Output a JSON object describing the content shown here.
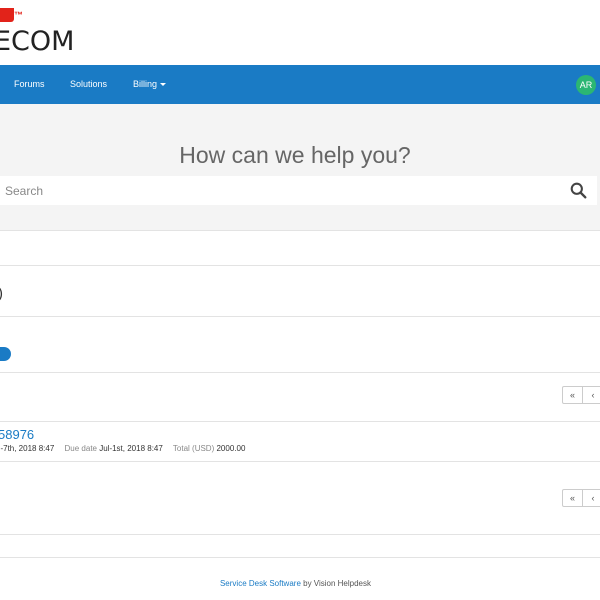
{
  "brand": {
    "logo_tm": "™",
    "logo_text": "ECOM"
  },
  "nav": {
    "items": [
      {
        "label": "Forums"
      },
      {
        "label": "Solutions"
      },
      {
        "label": "Billing"
      }
    ],
    "avatar_initials": "AR"
  },
  "hero": {
    "title": "How can we help you?",
    "search_placeholder": "Search"
  },
  "section": {
    "heading_fragment": ")"
  },
  "pager": {
    "first_label": "«",
    "prev_label": "‹"
  },
  "invoice": {
    "number": "58976",
    "created_fragment": "n-7th, 2018 8:47",
    "due_label": "Due date",
    "due_value": "Jul-1st, 2018 8:47",
    "total_label": "Total (USD)",
    "total_value": "2000.00"
  },
  "footer": {
    "link_text": "Service Desk Software",
    "suffix": " by Vision Helpdesk"
  },
  "colors": {
    "primary": "#1a7bc5",
    "brand_red": "#e2231a",
    "avatar": "#2bb673"
  }
}
